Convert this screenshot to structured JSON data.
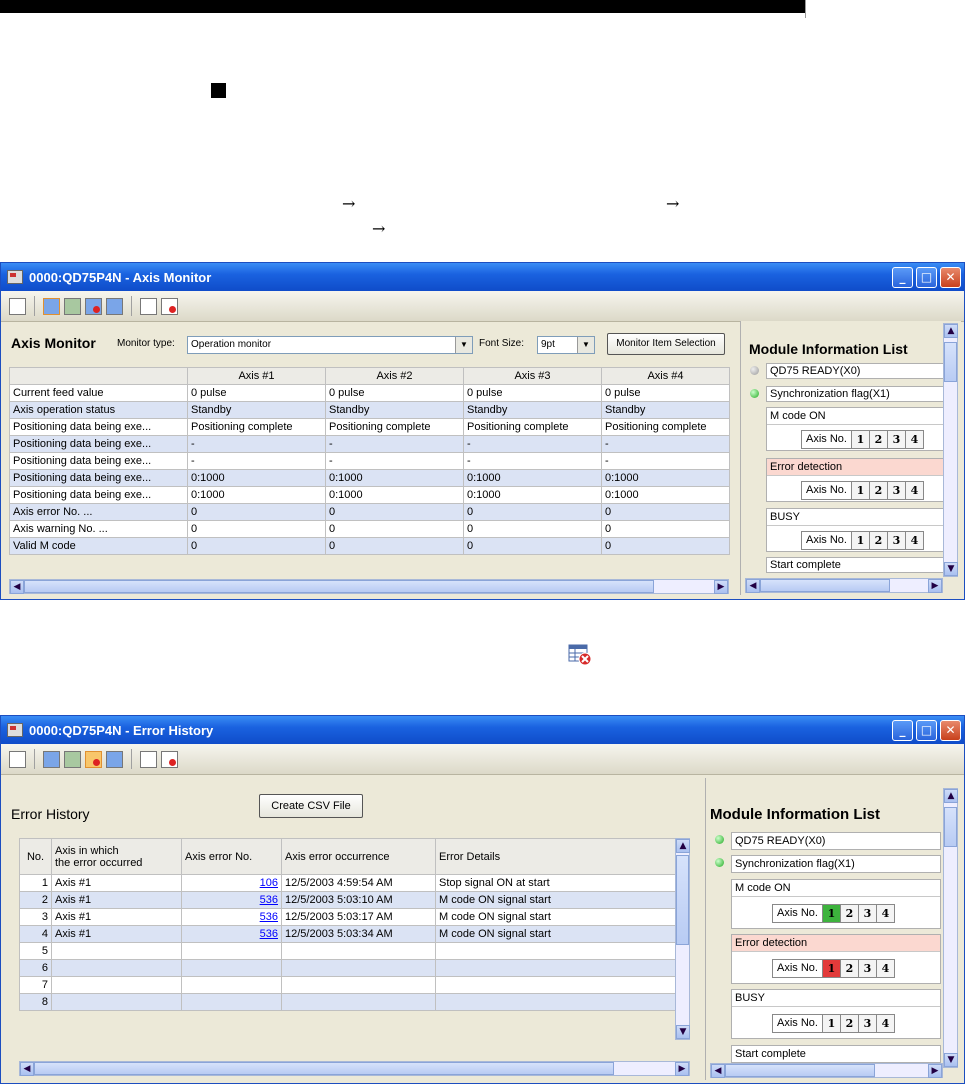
{
  "page": {
    "arrow": "→"
  },
  "axis_monitor": {
    "title": "0000:QD75P4N - Axis Monitor",
    "header": "Axis Monitor",
    "monitor_type_label": "Monitor type:",
    "monitor_type_value": "Operation monitor",
    "font_size_label": "Font Size:",
    "font_size_value": "9pt",
    "monitor_item_selection_label": "Monitor Item Selection",
    "columns": [
      "Axis #1",
      "Axis #2",
      "Axis #3",
      "Axis #4"
    ],
    "rows": [
      {
        "label": "Current feed value",
        "values": [
          "0 pulse",
          "0 pulse",
          "0 pulse",
          "0 pulse"
        ]
      },
      {
        "label": "Axis operation status",
        "values": [
          "Standby",
          "Standby",
          "Standby",
          "Standby"
        ]
      },
      {
        "label": "Positioning data being exe...",
        "values": [
          "Positioning complete",
          "Positioning complete",
          "Positioning complete",
          "Positioning complete"
        ]
      },
      {
        "label": "Positioning data being exe...",
        "values": [
          "-",
          "-",
          "-",
          "-"
        ]
      },
      {
        "label": "Positioning data being exe...",
        "values": [
          "-",
          "-",
          "-",
          "-"
        ]
      },
      {
        "label": "Positioning data being exe...",
        "values": [
          "0:1000",
          "0:1000",
          "0:1000",
          "0:1000"
        ]
      },
      {
        "label": "Positioning data being exe...",
        "values": [
          "0:1000",
          "0:1000",
          "0:1000",
          "0:1000"
        ]
      },
      {
        "label": "Axis error No. ...",
        "values": [
          "0",
          "0",
          "0",
          "0"
        ]
      },
      {
        "label": "Axis warning No. ...",
        "values": [
          "0",
          "0",
          "0",
          "0"
        ]
      },
      {
        "label": "Valid M code",
        "values": [
          "0",
          "0",
          "0",
          "0"
        ]
      }
    ],
    "mil": {
      "header": "Module Information List",
      "ready": "QD75 READY(X0)",
      "sync": "Synchronization flag(X1)",
      "mcode": "M code ON",
      "error": "Error detection",
      "busy": "BUSY",
      "start": "Start complete",
      "axis_label": "Axis No.",
      "axes": [
        "1",
        "2",
        "3",
        "4"
      ]
    }
  },
  "error_history": {
    "title": "0000:QD75P4N - Error History",
    "header": "Error History",
    "csv_button": "Create CSV File",
    "columns": [
      "No.",
      "Axis in which\n the error occurred",
      "Axis error No.",
      "Axis error occurrence",
      "Error Details"
    ],
    "rows": [
      {
        "no": "1",
        "axis": "Axis #1",
        "code": "106",
        "time": "12/5/2003 4:59:54 AM",
        "detail": "Stop signal ON at start"
      },
      {
        "no": "2",
        "axis": "Axis #1",
        "code": "536",
        "time": "12/5/2003 5:03:10 AM",
        "detail": "M code ON signal start"
      },
      {
        "no": "3",
        "axis": "Axis #1",
        "code": "536",
        "time": "12/5/2003 5:03:17 AM",
        "detail": "M code ON signal start"
      },
      {
        "no": "4",
        "axis": "Axis #1",
        "code": "536",
        "time": "12/5/2003 5:03:34 AM",
        "detail": "M code ON signal start"
      },
      {
        "no": "5",
        "axis": "",
        "code": "",
        "time": "",
        "detail": ""
      },
      {
        "no": "6",
        "axis": "",
        "code": "",
        "time": "",
        "detail": ""
      },
      {
        "no": "7",
        "axis": "",
        "code": "",
        "time": "",
        "detail": ""
      },
      {
        "no": "8",
        "axis": "",
        "code": "",
        "time": "",
        "detail": ""
      }
    ],
    "mil": {
      "header": "Module Information List",
      "ready": "QD75 READY(X0)",
      "sync": "Synchronization flag(X1)",
      "mcode": "M code ON",
      "error": "Error detection",
      "busy": "BUSY",
      "start": "Start complete",
      "axis_label": "Axis No.",
      "axes": [
        "1",
        "2",
        "3",
        "4"
      ],
      "mcode_active_axis": "1",
      "error_active_axis": "1"
    }
  }
}
